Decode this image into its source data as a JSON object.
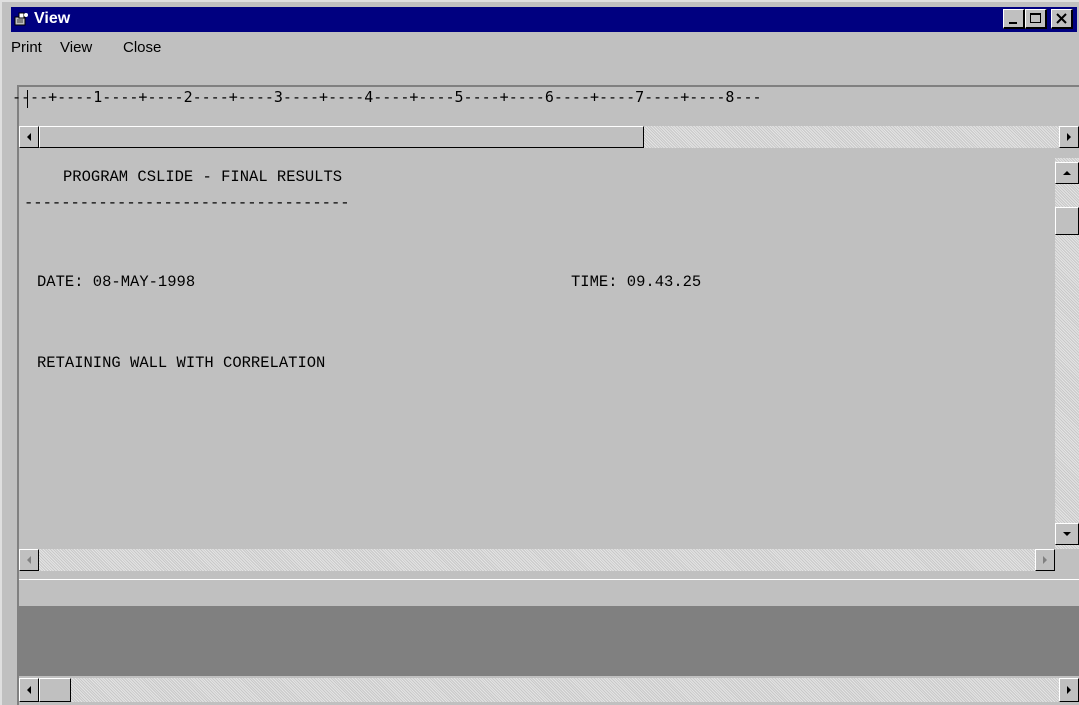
{
  "window": {
    "title": "View",
    "icon": "app-icon"
  },
  "menu": {
    "items": [
      "Print",
      "View",
      "Close"
    ]
  },
  "ruler": {
    "text": "----+----1----+----2----+----3----+----4----+----5----+----6----+----7----+----8---"
  },
  "document": {
    "heading": "PROGRAM CSLIDE - FINAL RESULTS",
    "underline": "-----------------------------------",
    "date": "DATE: 08-MAY-1998",
    "time": "TIME: 09.43.25",
    "subject": "RETAINING WALL WITH CORRELATION"
  },
  "colors": {
    "titlebar": "#000080",
    "face": "#c0c0c0",
    "dark_panel": "#808080"
  }
}
